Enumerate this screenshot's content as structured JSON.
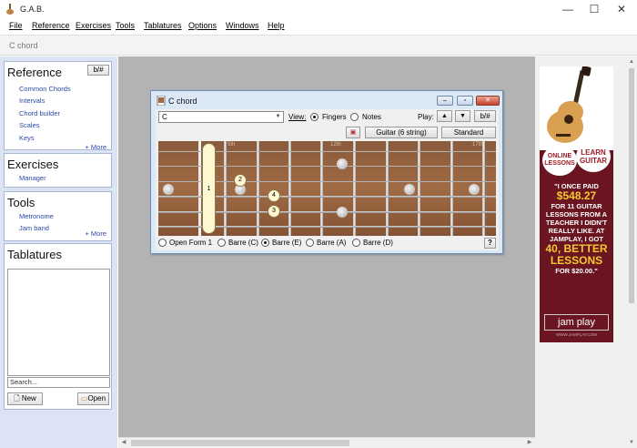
{
  "window": {
    "title": "G.A.B.",
    "minimize": "—",
    "maximize": "☐",
    "close": "✕"
  },
  "menu": [
    "File",
    "Reference",
    "Exercises",
    "Tools",
    "Tablatures",
    "Options",
    "Windows",
    "Help"
  ],
  "doc_tab": "C chord",
  "reference": {
    "title": "Reference",
    "toggle": "b/#",
    "links": [
      "Common Chords",
      "Intervals",
      "Chord builder",
      "Scales",
      "Keys"
    ],
    "more": "+ More"
  },
  "exercises": {
    "title": "Exercises",
    "links": [
      "Manager"
    ]
  },
  "tools": {
    "title": "Tools",
    "links": [
      "Metronome",
      "Jam band"
    ],
    "more": "+ More"
  },
  "tablatures": {
    "title": "Tablatures",
    "search_placeholder": "Search...",
    "new_label": "New",
    "open_label": "Open"
  },
  "chord_window": {
    "title": "C chord",
    "chord_value": "C",
    "view_label": "View:",
    "view_fingers": "Fingers",
    "view_notes": "Notes",
    "play_label": "Play:",
    "accidental_toggle": "b/#",
    "instrument": "Guitar (6 string)",
    "tuning": "Standard",
    "fret_labels": [
      "5th",
      "12th",
      "17th"
    ],
    "fingers": [
      "1",
      "2",
      "4",
      "3"
    ],
    "forms": [
      "Open Form 1",
      "Barre (C)",
      "Barre (E)",
      "Barre (A)",
      "Barre (D)"
    ],
    "selected_form": "Barre (E)",
    "help": "?"
  },
  "ad": {
    "bubble_left": "ONLINE LESSONS",
    "bubble_right": "LEARN GUITAR",
    "line1": "\"I ONCE PAID",
    "price1": "$548.27",
    "line2": "FOR 11 GUITAR LESSONS FROM A TEACHER I DIDN'T REALLY LIKE. AT JAMPLAY, I GOT",
    "big2": "40, BETTER LESSONS",
    "line3": "FOR $20.00.\"",
    "brand": "jam play",
    "url": "WWW.JAMPLAY.COM"
  }
}
